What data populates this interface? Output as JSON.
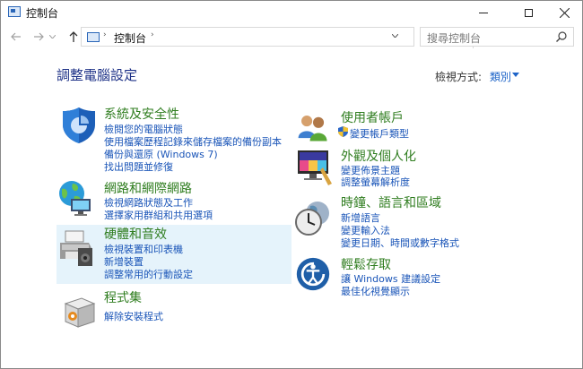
{
  "window": {
    "title": "控制台"
  },
  "address": {
    "path": "控制台",
    "sep": "›"
  },
  "search": {
    "placeholder": "搜尋控制台"
  },
  "main": {
    "title": "調整電腦設定",
    "viewby_label": "檢視方式:",
    "viewby_value": "類別"
  },
  "categories": {
    "system_security": {
      "title": "系統及安全性",
      "links": [
        "檢閱您的電腦狀態",
        "使用檔案歷程記錄來儲存檔案的備份副本",
        "備份與還原 (Windows 7)",
        "找出問題並修復"
      ]
    },
    "network": {
      "title": "網路和網際網路",
      "links": [
        "檢視網路狀態及工作",
        "選擇家用群組和共用選項"
      ]
    },
    "hardware": {
      "title": "硬體和音效",
      "links": [
        "檢視裝置和印表機",
        "新增裝置",
        "調整常用的行動設定"
      ]
    },
    "programs": {
      "title": "程式集",
      "links": [
        "解除安裝程式"
      ]
    },
    "user_accounts": {
      "title": "使用者帳戶",
      "links": [
        "變更帳戶類型"
      ]
    },
    "appearance": {
      "title": "外觀及個人化",
      "links": [
        "變更佈景主題",
        "調整螢幕解析度"
      ]
    },
    "clock": {
      "title": "時鐘、語言和區域",
      "links": [
        "新增語言",
        "變更輸入法",
        "變更日期、時間或數字格式"
      ]
    },
    "ease": {
      "title": "輕鬆存取",
      "links": [
        "讓 Windows 建議設定",
        "最佳化視覺顯示"
      ]
    }
  },
  "colors": {
    "category_title": "#2f7d1f",
    "link": "#1a55b8",
    "page_title": "#1e3287",
    "highlight": "#e5f3fb"
  },
  "icons": {
    "back": "arrow-left-icon",
    "forward": "arrow-right-icon",
    "up": "arrow-up-icon",
    "refresh": "refresh-icon",
    "search": "search-icon"
  }
}
